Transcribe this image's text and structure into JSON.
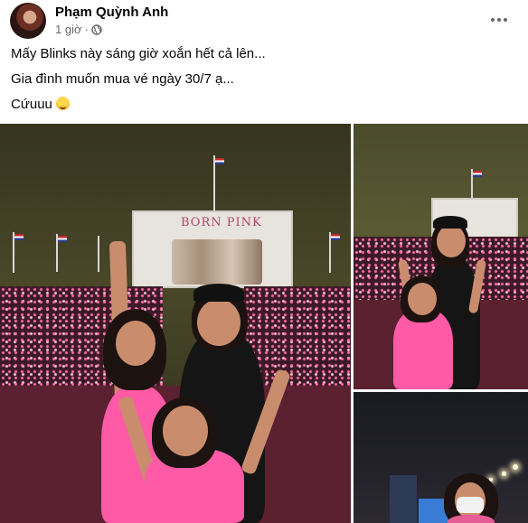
{
  "post": {
    "author": "Phạm Quỳnh Anh",
    "time": "1 giờ",
    "privacy_icon": "globe-icon",
    "more_icon": "more-options-icon",
    "lines": [
      "Mấy Blinks này sáng giờ xoắn hết cả lên...",
      "Gia đình muốn mua vé ngày 30/7 ạ...",
      "Cứuuu"
    ],
    "emoji": "smiling-face-emoji"
  },
  "photos": {
    "screen_text": "BORN PINK",
    "items": [
      "concert-photo-1",
      "concert-photo-2",
      "concert-photo-3"
    ]
  },
  "colors": {
    "text": "#050505",
    "secondary": "#65676b",
    "pink": "#ff5aa6"
  }
}
